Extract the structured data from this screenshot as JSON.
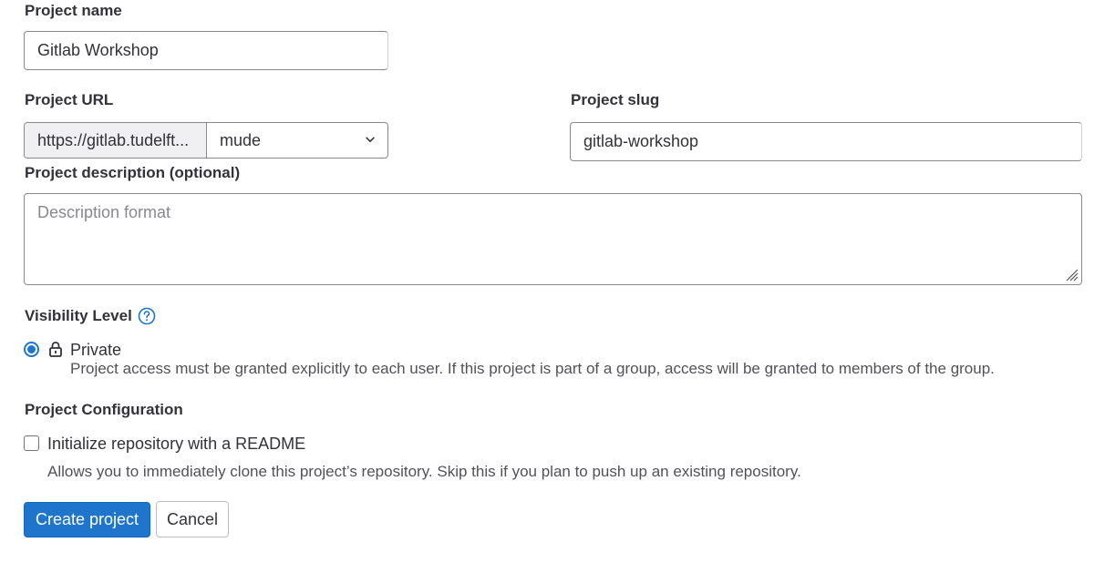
{
  "project_name": {
    "label": "Project name",
    "value": "Gitlab Workshop"
  },
  "project_url": {
    "label": "Project URL",
    "prefix": "https://gitlab.tudelft...",
    "namespace": "mude"
  },
  "project_slug": {
    "label": "Project slug",
    "value": "gitlab-workshop"
  },
  "project_description": {
    "label": "Project description (optional)",
    "placeholder": "Description format"
  },
  "visibility": {
    "label": "Visibility Level",
    "option_label": "Private",
    "option_help": "Project access must be granted explicitly to each user. If this project is part of a group, access will be granted to members of the group."
  },
  "configuration": {
    "label": "Project Configuration",
    "readme_label": "Initialize repository with a README",
    "readme_help": "Allows you to immediately clone this project’s repository. Skip this if you plan to push up an existing repository."
  },
  "actions": {
    "create_label": "Create project",
    "cancel_label": "Cancel"
  },
  "colors": {
    "primary": "#1f75cb",
    "border": "#89888d",
    "text": "#333238"
  }
}
